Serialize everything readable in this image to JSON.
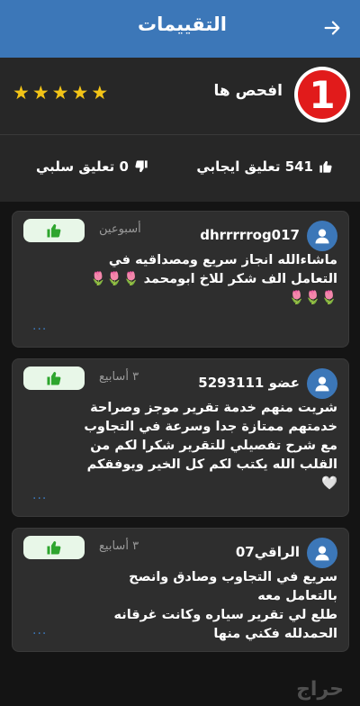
{
  "header": {
    "title": "التقييمات",
    "back_icon": "arrow-right-icon"
  },
  "seller": {
    "name": "افحص ها",
    "rating_stars": 5,
    "star_color": "#f3c417",
    "logo_text": "1"
  },
  "stats": {
    "positive": "541 تعليق ايجابي",
    "negative": "0 تعليق سلبي"
  },
  "reviews": [
    {
      "user": "dhrrrrrog017",
      "time": "أسبوعين",
      "text": "ماشاءالله انجاز سريع ومصداقيه في\nالتعامل الف شكر للاخ ابومحمد 🌷🌷🌷\n🌷🌷🌷",
      "more": "..."
    },
    {
      "user": "عضو 5293111",
      "time": "٣ أسابيع",
      "text": "شريت منهم خدمة تقرير موجز وصراحة\nخدمتهم ممتازة جدا وسرعة في التجاوب\nمع شرح تفصيلي للتقرير  شكرا لكم من\nالقلب الله يكتب لكم كل الخير ويوفقكم\n🤍",
      "more": "..."
    },
    {
      "user": "الراقي07",
      "time": "٣ أسابيع",
      "text": "سريع في التجاوب وصادق وانصح\nبالتعامل معه\nطلع لي تقرير سياره وكانت غرقانه\nالحمدلله فكني منها",
      "more": "..."
    }
  ],
  "watermark": "حراج",
  "colors": {
    "accent": "#3c77b8",
    "positive_badge_bg": "#e8f7e8",
    "thumb_green": "#2ea52e"
  }
}
